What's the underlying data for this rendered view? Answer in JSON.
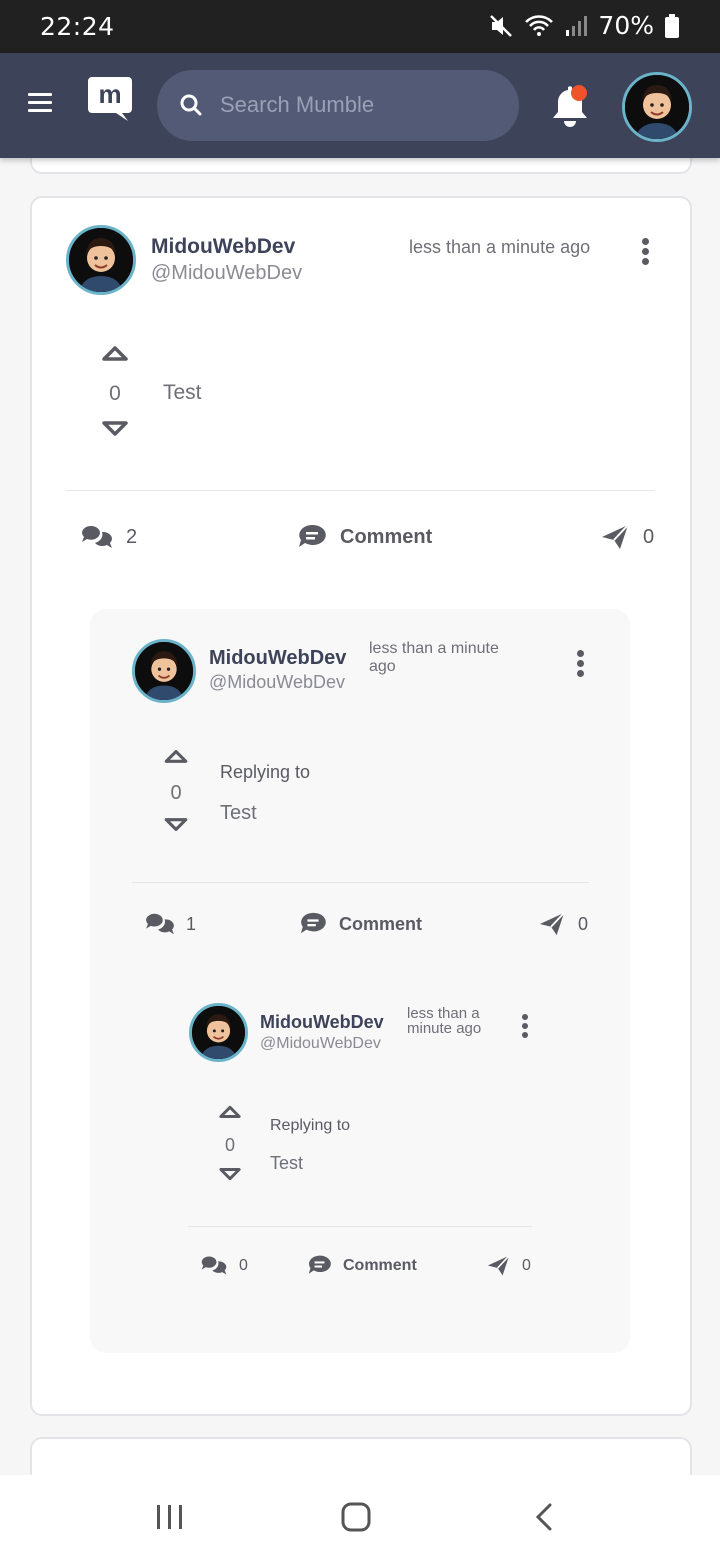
{
  "status_bar": {
    "time": "22:24",
    "battery": "70%"
  },
  "header": {
    "search_placeholder": "Search Mumble"
  },
  "post": {
    "username": "MidouWebDev",
    "handle": "@MidouWebDev",
    "time": "less than a minute ago",
    "votes": "0",
    "content": "Test",
    "comments_count": "2",
    "comment_label": "Comment",
    "shares_count": "0"
  },
  "reply1": {
    "username": "MidouWebDev",
    "handle": "@MidouWebDev",
    "time_line1": "less than a minute",
    "time_line2": "ago",
    "votes": "0",
    "replying_to": "Replying to",
    "content": "Test",
    "comments_count": "1",
    "comment_label": "Comment",
    "shares_count": "0"
  },
  "reply2": {
    "username": "MidouWebDev",
    "handle": "@MidouWebDev",
    "time_line1": "less than a",
    "time_line2": "minute ago",
    "votes": "0",
    "replying_to": "Replying to",
    "content": "Test",
    "comments_count": "0",
    "comment_label": "Comment",
    "shares_count": "0"
  },
  "colors": {
    "header": "#3d4359",
    "accent_avatar_ring": "#6bb3c9",
    "notification_dot": "#f0522a"
  }
}
